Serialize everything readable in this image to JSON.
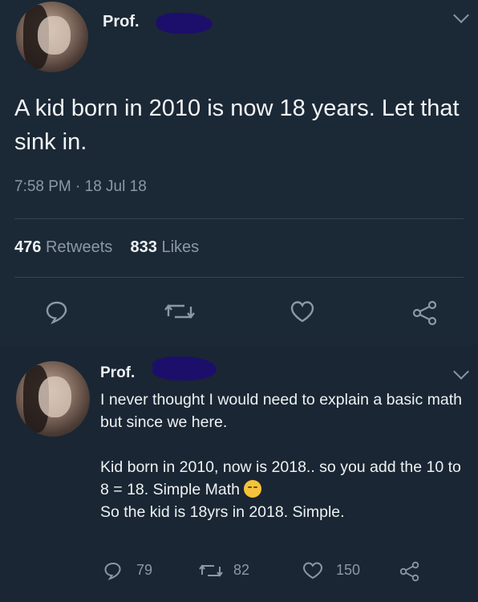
{
  "main_tweet": {
    "author_name": "Prof.",
    "text": "A kid born in 2010 is now 18 years. Let that sink in.",
    "timestamp": "7:58 PM · 18 Jul 18",
    "retweets_count": "476",
    "retweets_label": "Retweets",
    "likes_count": "833",
    "likes_label": "Likes",
    "actions": [
      "reply-icon",
      "retweet-icon",
      "like-icon",
      "share-icon"
    ]
  },
  "reply_tweet": {
    "author_name": "Prof.",
    "line1": "I never thought I would need to explain a basic math but since we here.",
    "line2": "Kid born in 2010, now is 2018.. so you add the 10 to 8 = 18. Simple Math",
    "line3": "So the kid is 18yrs in 2018. Simple.",
    "reply_count": "79",
    "retweet_count": "82",
    "like_count": "150"
  },
  "colors": {
    "background": "#1b2836",
    "text": "#eef1f3",
    "muted": "#8b98a5",
    "divider": "#38444d"
  }
}
